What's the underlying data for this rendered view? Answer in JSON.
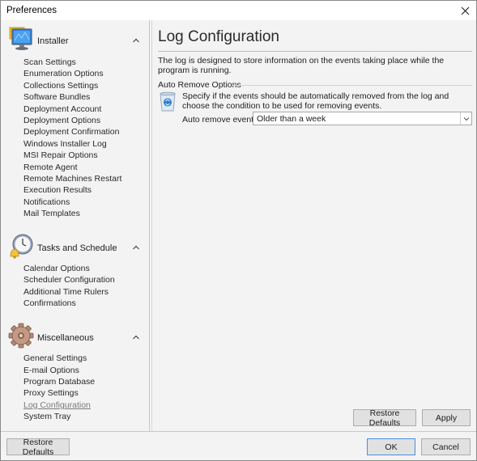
{
  "window": {
    "title": "Preferences",
    "close_icon": "close-icon"
  },
  "sidebar": {
    "groups": [
      {
        "label": "Installer",
        "icon": "monitor-icon",
        "expanded": true,
        "items": [
          {
            "label": "Scan Settings"
          },
          {
            "label": "Enumeration Options"
          },
          {
            "label": "Collections Settings"
          },
          {
            "label": "Software Bundles"
          },
          {
            "label": "Deployment Account"
          },
          {
            "label": "Deployment Options"
          },
          {
            "label": "Deployment Confirmation"
          },
          {
            "label": "Windows Installer Log"
          },
          {
            "label": "MSI Repair Options"
          },
          {
            "label": "Remote Agent"
          },
          {
            "label": "Remote Machines Restart"
          },
          {
            "label": "Execution Results"
          },
          {
            "label": "Notifications"
          },
          {
            "label": "Mail Templates"
          }
        ]
      },
      {
        "label": "Tasks and Schedule",
        "icon": "clock-bell-icon",
        "expanded": true,
        "items": [
          {
            "label": "Calendar Options"
          },
          {
            "label": "Scheduler Configuration"
          },
          {
            "label": "Additional Time Rulers"
          },
          {
            "label": "Confirmations"
          }
        ]
      },
      {
        "label": "Miscellaneous",
        "icon": "gear-icon",
        "expanded": true,
        "items": [
          {
            "label": "General Settings"
          },
          {
            "label": "E-mail Options"
          },
          {
            "label": "Program Database"
          },
          {
            "label": "Proxy Settings"
          },
          {
            "label": "Log Configuration",
            "active": true
          },
          {
            "label": "System Tray"
          }
        ]
      }
    ]
  },
  "content": {
    "title": "Log Configuration",
    "description": "The log is designed to store information on the events taking place while the program is running.",
    "section": {
      "label": "Auto Remove Options",
      "icon": "recycle-bin-icon",
      "description": "Specify if the events should be automatically removed from the log and choose the condition to be used for removing events.",
      "field_label": "Auto remove events:",
      "field_value": "Older than a week"
    },
    "buttons": {
      "restore_defaults": "Restore Defaults",
      "apply": "Apply"
    }
  },
  "footer": {
    "restore_defaults": "Restore Defaults",
    "ok": "OK",
    "cancel": "Cancel"
  }
}
